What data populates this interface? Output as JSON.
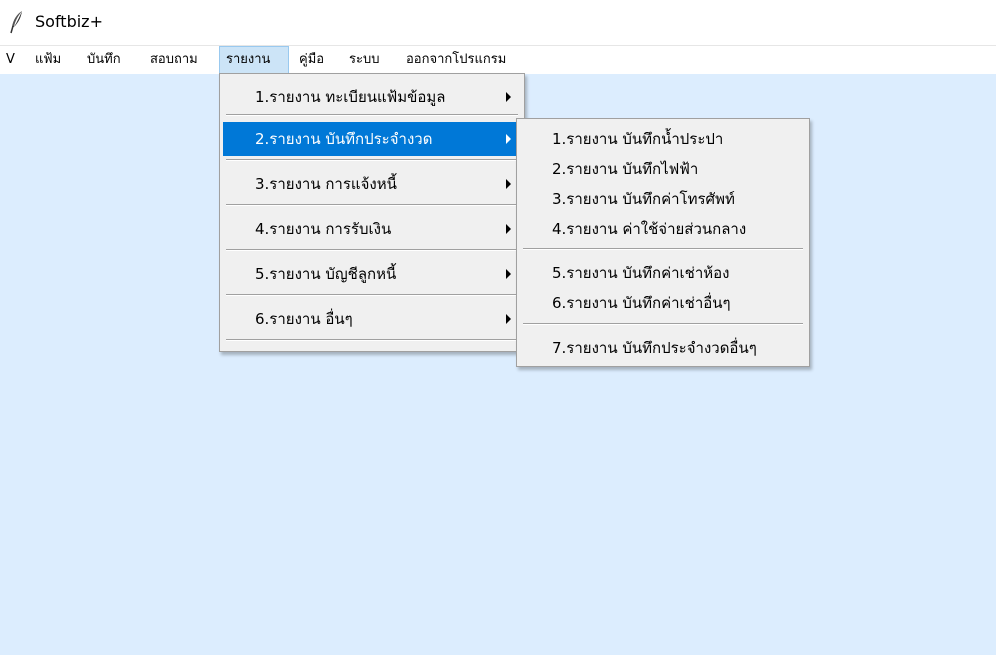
{
  "window": {
    "title": "Softbiz+",
    "icon": "feather-icon"
  },
  "menubar": {
    "items": [
      {
        "label": "V"
      },
      {
        "label": "แฟ้ม"
      },
      {
        "label": "บันทึก"
      },
      {
        "label": "สอบถาม"
      },
      {
        "label": "รายงาน",
        "active": true
      },
      {
        "label": "คู่มือ"
      },
      {
        "label": "ระบบ"
      },
      {
        "label": "ออกจากโปรแกรม"
      }
    ]
  },
  "report_menu": {
    "items": [
      {
        "label": "1.รายงาน ทะเบียนแฟ้มข้อมูล",
        "has_submenu": true
      },
      {
        "label": "2.รายงาน บันทึกประจำงวด",
        "has_submenu": true,
        "selected": true
      },
      {
        "label": "3.รายงาน การแจ้งหนี้",
        "has_submenu": true
      },
      {
        "label": "4.รายงาน การรับเงิน",
        "has_submenu": true
      },
      {
        "label": "5.รายงาน บัญชีลูกหนี้",
        "has_submenu": true
      },
      {
        "label": "6.รายงาน อื่นๆ",
        "has_submenu": true
      }
    ]
  },
  "period_submenu": {
    "items": [
      {
        "label": "1.รายงาน บันทึกน้ำประปา"
      },
      {
        "label": "2.รายงาน บันทึกไฟฟ้า"
      },
      {
        "label": "3.รายงาน บันทึกค่าโทรศัพท์"
      },
      {
        "label": "4.รายงาน ค่าใช้จ่ายส่วนกลาง"
      },
      {
        "label": "5.รายงาน บันทึกค่าเช่าห้อง"
      },
      {
        "label": "6.รายงาน บันทึกค่าเช่าอื่นๆ"
      },
      {
        "label": "7.รายงาน บันทึกประจำงวดอื่นๆ"
      }
    ]
  },
  "colors": {
    "workspace": "#dcedfe",
    "menu_background": "#f0f0f0",
    "selection": "#0078d7",
    "menubar_active": "#cce4f7"
  }
}
